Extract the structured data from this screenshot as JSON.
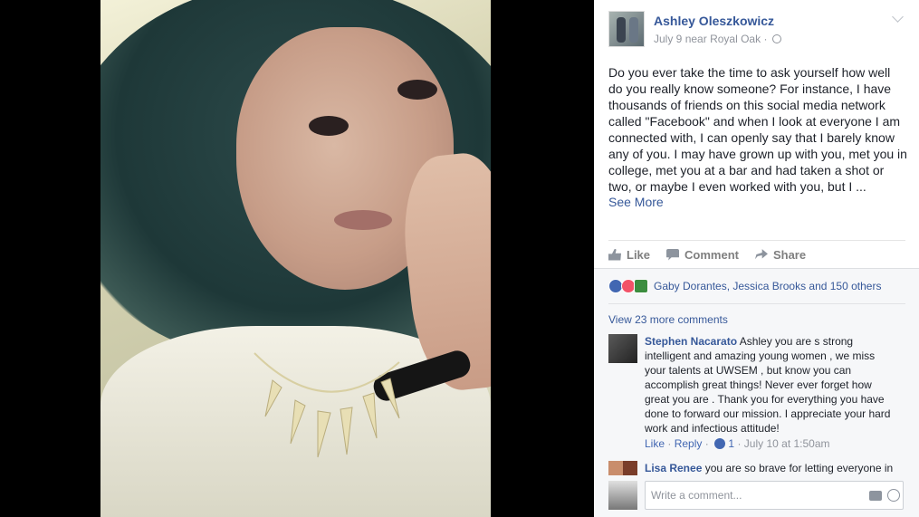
{
  "post": {
    "author": "Ashley Oleszkowicz",
    "date": "July 9",
    "near": "near",
    "location": "Royal Oak",
    "separator": "·",
    "text": "Do you ever take the time to ask yourself how well do you really know someone? For instance, I have thousands of friends on this social media network called \"Facebook\" and when I look at everyone I am connected with, I can openly say that I barely know any of you. I may have grown up with you, met you in college, met you at a bar and had taken a shot or two, or maybe I even worked with you, but I ...",
    "see_more": "See More"
  },
  "actions": {
    "like": "Like",
    "comment": "Comment",
    "share": "Share"
  },
  "reactions": {
    "names": "Gaby Dorantes, Jessica Brooks and 150 others",
    "icons": [
      "like",
      "love",
      "special"
    ]
  },
  "comments": {
    "view_more": "View 23 more comments",
    "items": [
      {
        "name": "Stephen Nacarato",
        "text": "Ashley you are s strong intelligent and amazing young women , we miss your talents at UWSEM , but know you can accomplish great things! Never ever forget how great you are . Thank you for everything you have done to forward our mission. I appreciate your hard work and infectious attitude!",
        "like": "Like",
        "reply": "Reply",
        "likes": "1",
        "time": "July 10 at 1:50am"
      },
      {
        "name": "Lisa Renee",
        "text": "you are so brave for letting everyone in"
      }
    ],
    "write_placeholder": "Write a comment..."
  },
  "colors": {
    "link": "#365899",
    "meta": "#90949c",
    "viewer_bg": "#000000"
  }
}
